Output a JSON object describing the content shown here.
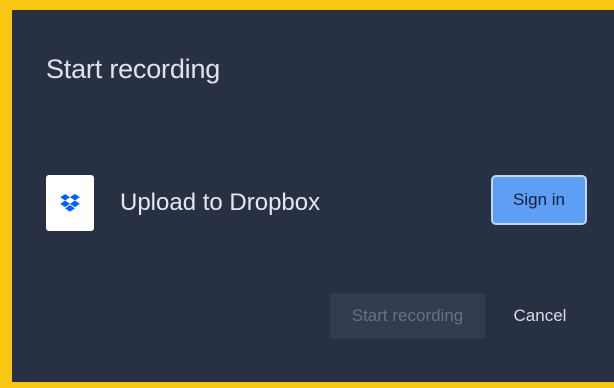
{
  "dialog": {
    "title": "Start recording"
  },
  "upload_row": {
    "icon": "dropbox-icon",
    "label": "Upload to Dropbox",
    "sign_in_label": "Sign in"
  },
  "footer": {
    "start_label": "Start recording",
    "start_enabled": false,
    "cancel_label": "Cancel"
  },
  "colors": {
    "frame_border": "#f9c613",
    "dialog_background": "#283143",
    "dropbox_blue": "#0061fe",
    "sign_in_button": "#5e9ff3"
  }
}
